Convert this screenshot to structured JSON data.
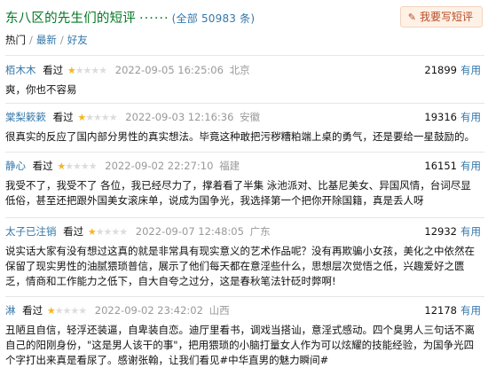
{
  "header": {
    "title": "东八区的先生们的短评",
    "dots": "······",
    "count": "(全部 50983 条)",
    "write_button": "我要写短评",
    "pen_icon": "pencil-icon"
  },
  "tabs": {
    "hot": "热门",
    "latest": "最新",
    "friends": "好友",
    "separator": "/"
  },
  "reviews": [
    {
      "user": "栢木木",
      "status": "看过",
      "rating": 1,
      "time": "2022-09-05 16:25:06",
      "location": "北京",
      "votes": "21899",
      "useful": "有用",
      "content": "爽，你也不容易"
    },
    {
      "user": "棠梨簌簌",
      "status": "看过",
      "rating": 1,
      "time": "2022-09-03 12:16:36",
      "location": "安徽",
      "votes": "19316",
      "useful": "有用",
      "content": "很真实的反应了国内部分男性的真实想法。毕竟这种敢把污秽糟粕端上桌的勇气，还是要给一星鼓励的。"
    },
    {
      "user": "静心",
      "status": "看过",
      "rating": 1,
      "time": "2022-09-02 22:27:10",
      "location": "福建",
      "votes": "16151",
      "useful": "有用",
      "content": "我受不了，我受不了 各位，我已经尽力了，撑着看了半集 泳池派对、比基尼美女、异国风情，台词尽显低俗，甚至还把跟外国美女滚床单，说成为国争光，我选择第一个把你开除国籍，真是丢人呀"
    },
    {
      "user": "太子已注销",
      "status": "看过",
      "rating": 1,
      "time": "2022-09-07 12:48:05",
      "location": "广东",
      "votes": "12932",
      "useful": "有用",
      "content": "说实话大家有没有想过这真的就是非常具有现实意义的艺术作品呢？没有再欺骗小女孩，美化之中依然在保留了现实男性的油腻猥琐普信，展示了他们每天都在意淫些什么，思想层次觉悟之低，兴趣爱好之匮乏，情商和工作能力之低下，自大自夸之过分，这是春秋笔法针砭时弊啊!"
    },
    {
      "user": "淋",
      "status": "看过",
      "rating": 1,
      "time": "2022-09-02 23:42:02",
      "location": "山西",
      "votes": "12178",
      "useful": "有用",
      "content": "丑陋且自信，轻浮还装逼，自卑装自恋。迪厅里看书，调戏当搭讪，意淫式感动。四个臭男人三句话不离自己的阳刚身份，\"这是男人该干的事\"，把用猥琐的小脑打量女人作为可以炫耀的技能经验，为国争光四个字打出来真是看尿了。感谢张翰，让我们看见#中华直男的魅力瞬间#"
    }
  ]
}
